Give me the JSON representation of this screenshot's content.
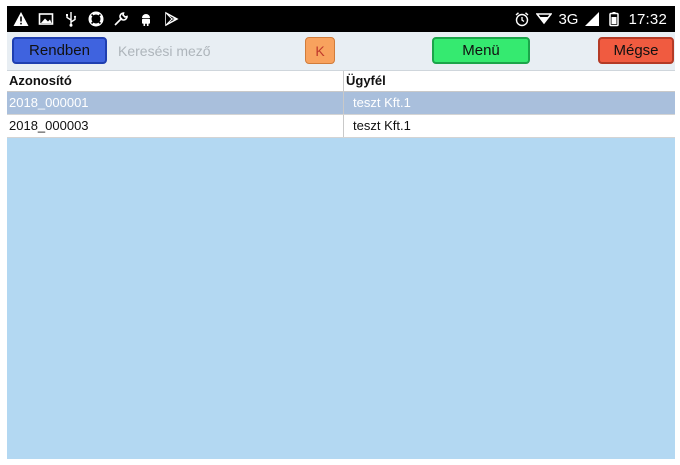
{
  "status_bar": {
    "left_icons": [
      "warning-icon",
      "image-icon",
      "usb-icon",
      "lifebuoy-icon",
      "wrench-icon",
      "android-icon",
      "play-store-icon"
    ],
    "alarm_icon": "alarm-icon",
    "signal_icon": "signal-icon",
    "network_type": "3G",
    "battery_icon": "battery-icon",
    "time": "17:32"
  },
  "toolbar": {
    "ok_label": "Rendben",
    "search_placeholder": "Keresési mező",
    "search_value": "",
    "k_label": "K",
    "menu_label": "Menü",
    "cancel_label": "Mégse"
  },
  "table": {
    "columns": [
      "Azonosító",
      "Ügyfél"
    ],
    "rows": [
      {
        "id": "2018_000001",
        "customer": "teszt Kft.1",
        "selected": true
      },
      {
        "id": "2018_000003",
        "customer": "teszt Kft.1",
        "selected": false
      }
    ]
  },
  "colors": {
    "background": "#b3d8f2",
    "ok_button": "#3f63df",
    "k_button": "#f8a25e",
    "menu_button": "#35ea70",
    "cancel_button": "#f05b40",
    "selected_row": "#a9bfdc"
  }
}
